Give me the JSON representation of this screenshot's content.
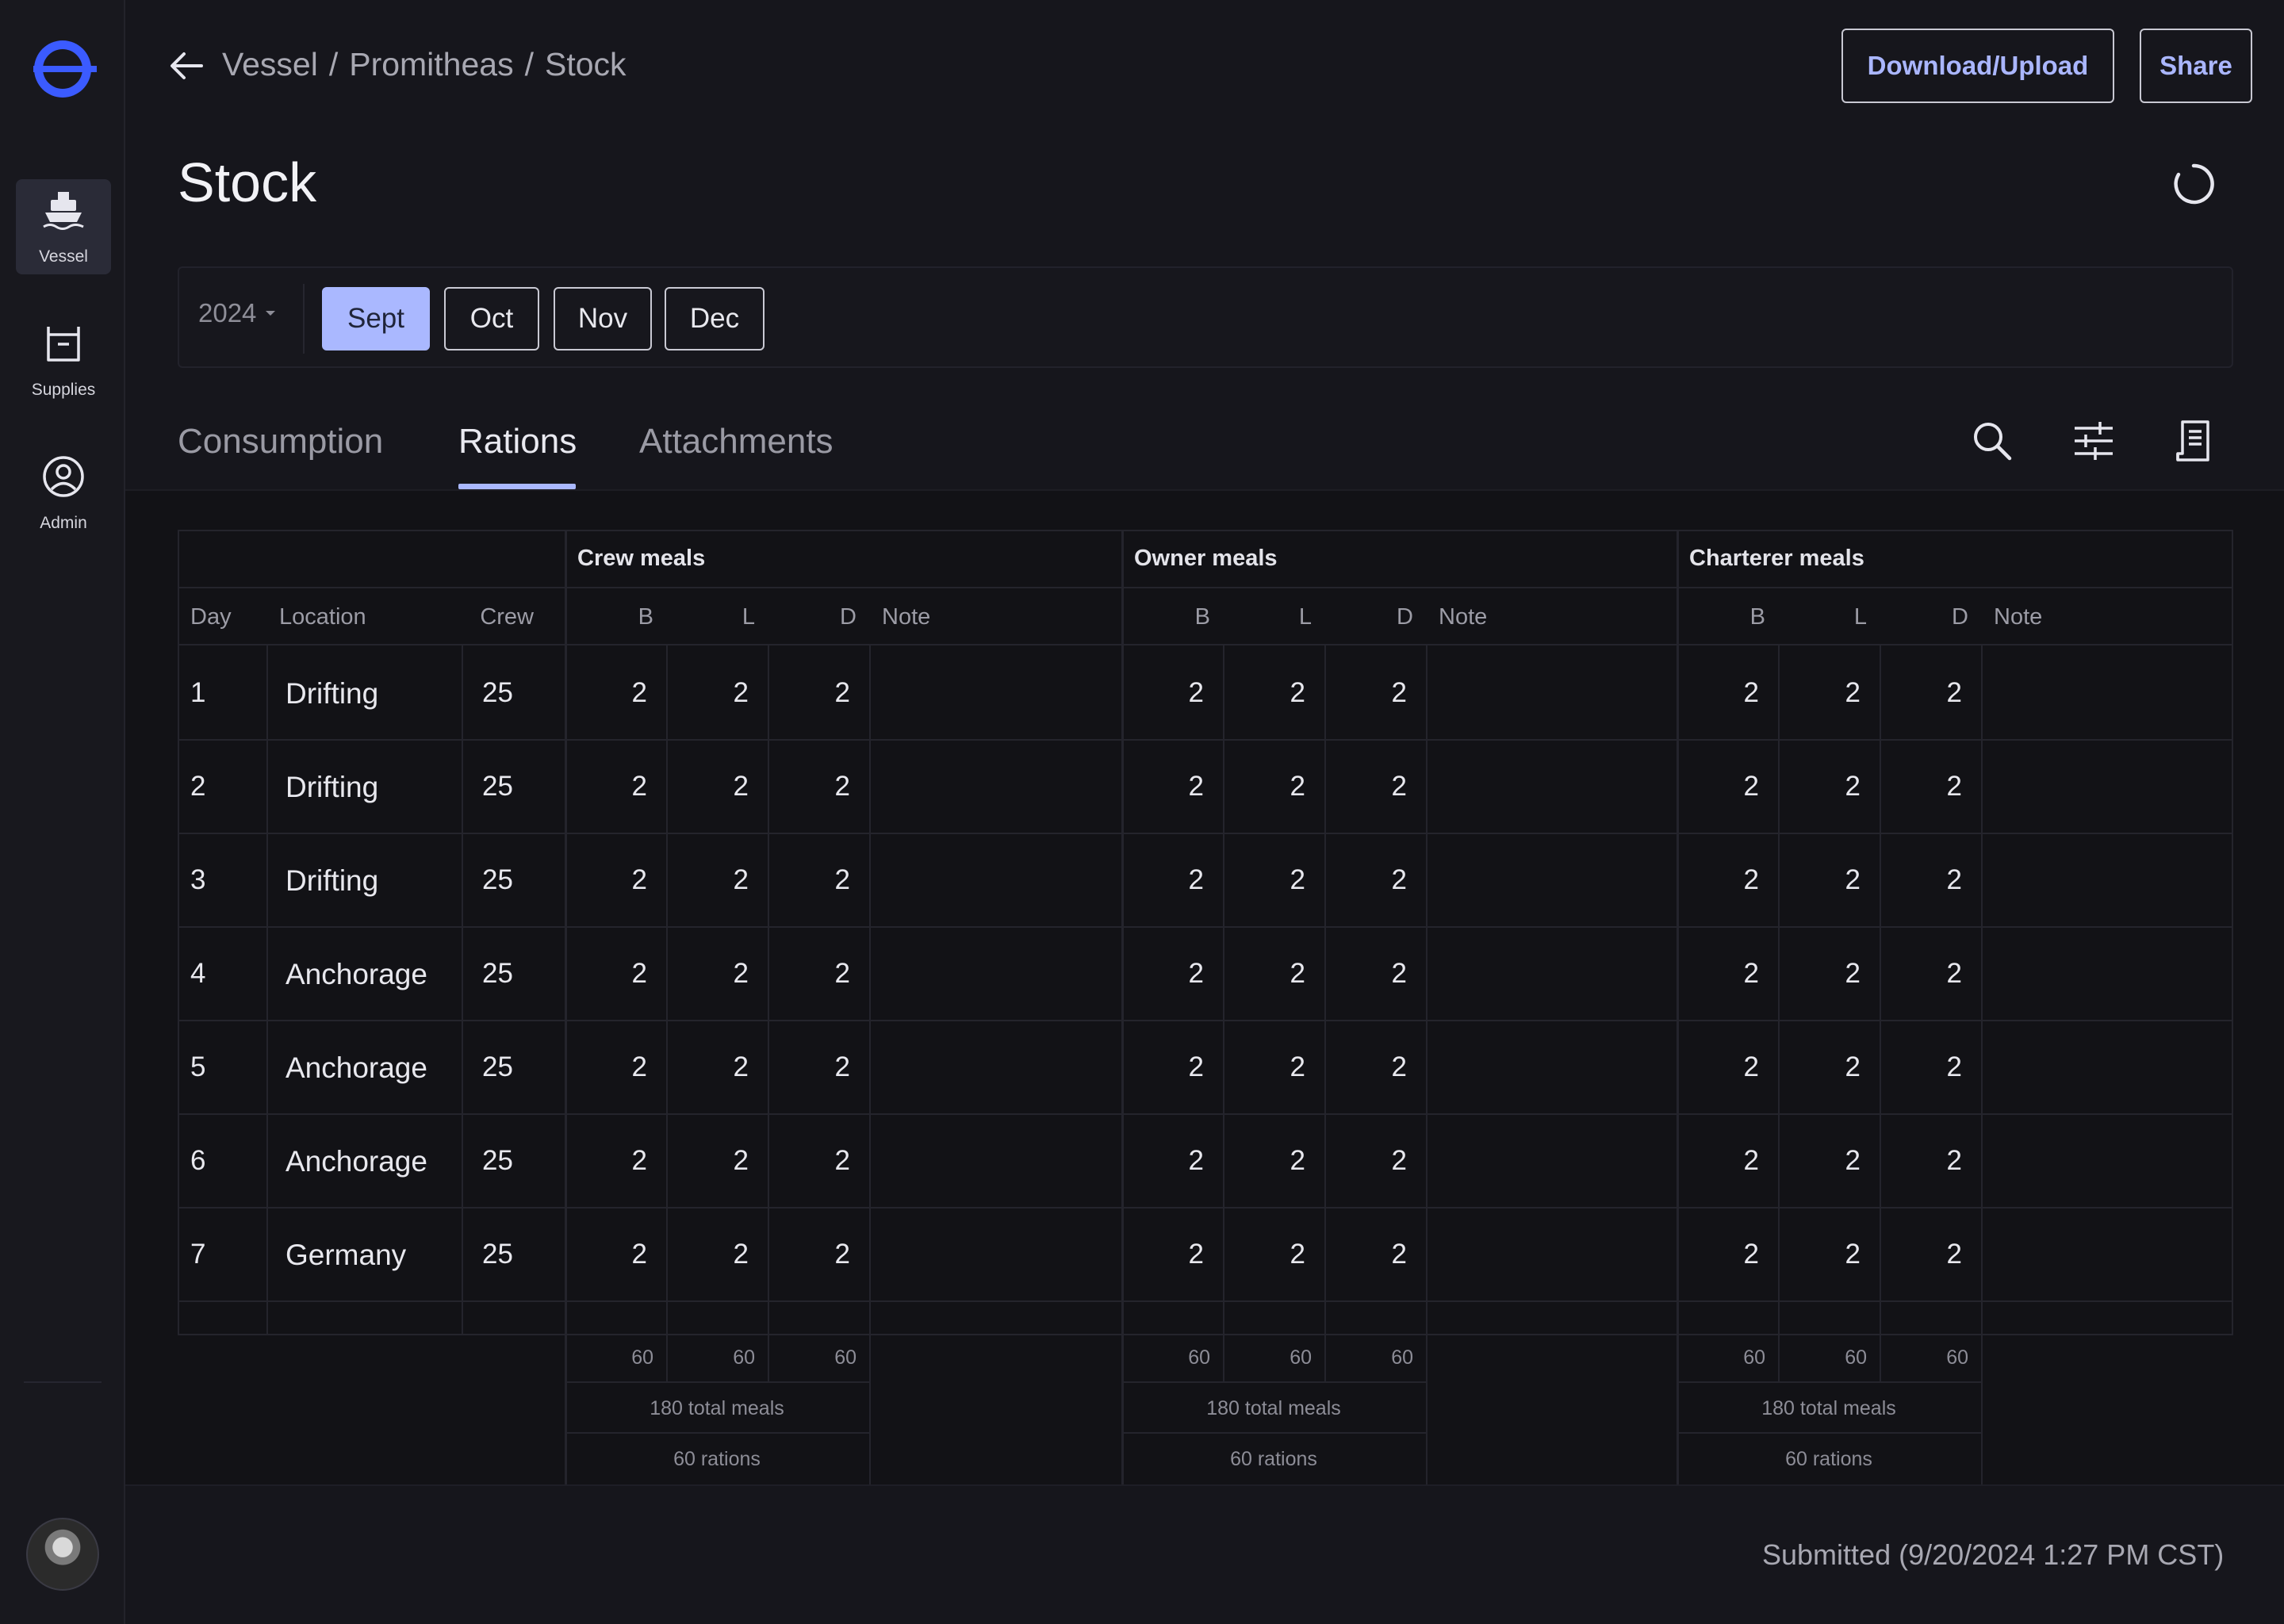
{
  "app": {
    "accent_color": "#aab8ff",
    "logo_icon": "app-logo"
  },
  "sidebar": {
    "items": [
      {
        "label": "Vessel",
        "icon": "ship-icon",
        "active": true
      },
      {
        "label": "Supplies",
        "icon": "box-icon",
        "active": false
      },
      {
        "label": "Admin",
        "icon": "user-circle-icon",
        "active": false
      }
    ]
  },
  "header": {
    "breadcrumb": [
      "Vessel",
      "Promitheas",
      "Stock"
    ],
    "separator": "/",
    "download_upload_label": "Download/Upload",
    "share_label": "Share",
    "page_title": "Stock"
  },
  "months": {
    "year": "2024",
    "items": [
      "Sept",
      "Oct",
      "Nov",
      "Dec"
    ],
    "active": "Sept"
  },
  "tabs": {
    "items": [
      "Consumption",
      "Rations",
      "Attachments"
    ],
    "active": "Rations"
  },
  "table": {
    "groups": [
      "Crew meals",
      "Owner meals",
      "Charterer meals"
    ],
    "fixed_columns": [
      "Day",
      "Location",
      "Crew"
    ],
    "meal_columns": [
      "B",
      "L",
      "D",
      "Note"
    ],
    "rows": [
      {
        "day": "1",
        "location": "Drifting",
        "crew": "25",
        "crew_meals": [
          "2",
          "2",
          "2"
        ],
        "owner_meals": [
          "2",
          "2",
          "2"
        ],
        "charterer_meals": [
          "2",
          "2",
          "2"
        ]
      },
      {
        "day": "2",
        "location": "Drifting",
        "crew": "25",
        "crew_meals": [
          "2",
          "2",
          "2"
        ],
        "owner_meals": [
          "2",
          "2",
          "2"
        ],
        "charterer_meals": [
          "2",
          "2",
          "2"
        ]
      },
      {
        "day": "3",
        "location": "Drifting",
        "crew": "25",
        "crew_meals": [
          "2",
          "2",
          "2"
        ],
        "owner_meals": [
          "2",
          "2",
          "2"
        ],
        "charterer_meals": [
          "2",
          "2",
          "2"
        ]
      },
      {
        "day": "4",
        "location": "Anchorage",
        "crew": "25",
        "crew_meals": [
          "2",
          "2",
          "2"
        ],
        "owner_meals": [
          "2",
          "2",
          "2"
        ],
        "charterer_meals": [
          "2",
          "2",
          "2"
        ]
      },
      {
        "day": "5",
        "location": "Anchorage",
        "crew": "25",
        "crew_meals": [
          "2",
          "2",
          "2"
        ],
        "owner_meals": [
          "2",
          "2",
          "2"
        ],
        "charterer_meals": [
          "2",
          "2",
          "2"
        ]
      },
      {
        "day": "6",
        "location": "Anchorage",
        "crew": "25",
        "crew_meals": [
          "2",
          "2",
          "2"
        ],
        "owner_meals": [
          "2",
          "2",
          "2"
        ],
        "charterer_meals": [
          "2",
          "2",
          "2"
        ]
      },
      {
        "day": "7",
        "location": "Germany",
        "crew": "25",
        "crew_meals": [
          "2",
          "2",
          "2"
        ],
        "owner_meals": [
          "2",
          "2",
          "2"
        ],
        "charterer_meals": [
          "2",
          "2",
          "2"
        ]
      }
    ],
    "totals": {
      "per_meal": [
        "60",
        "60",
        "60"
      ],
      "total_meals": "180 total meals",
      "rations": "60 rations"
    }
  },
  "status": {
    "submitted": "Submitted (9/20/2024 1:27 PM CST)"
  }
}
